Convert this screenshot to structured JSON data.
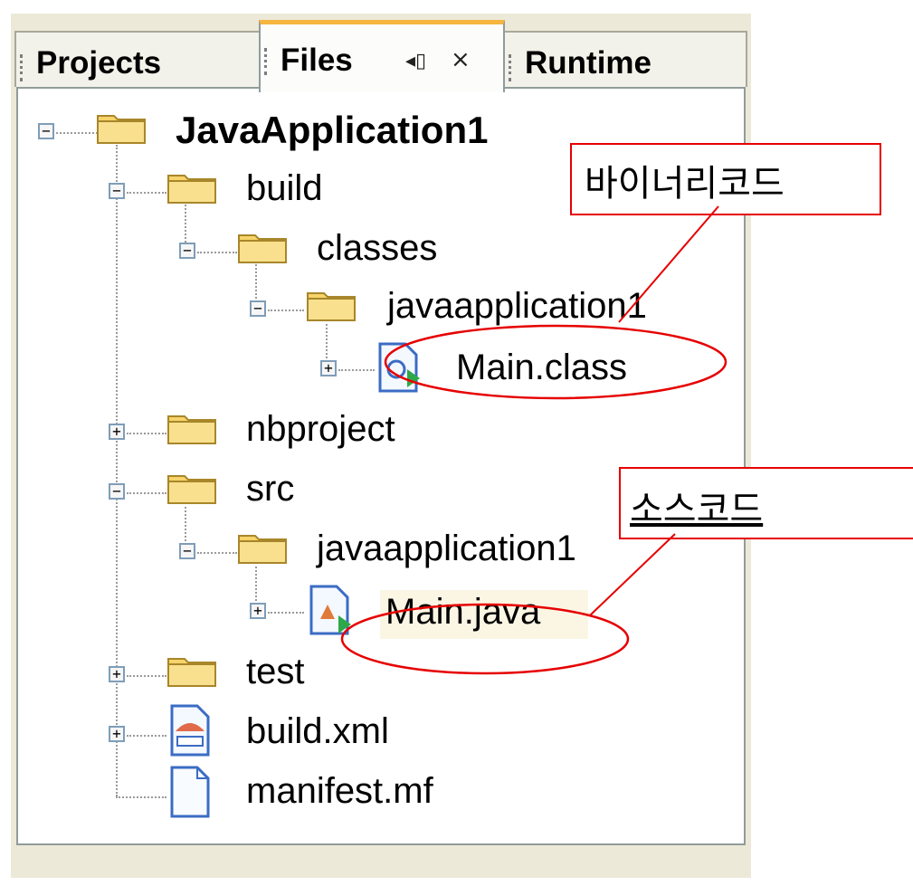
{
  "tabs": [
    {
      "label": "Projects"
    },
    {
      "label": "Files",
      "restore_icon": "◂▯",
      "close_icon": "×"
    },
    {
      "label": "Runtime"
    }
  ],
  "tree": {
    "root": "JavaApplication1",
    "build": "build",
    "classes": "classes",
    "pkg1": "javaapplication1",
    "main_class": "Main.class",
    "nbproject": "nbproject",
    "src": "src",
    "pkg2": "javaapplication1",
    "main_java": "Main.java",
    "test": "test",
    "build_xml": "build.xml",
    "manifest": "manifest.mf"
  },
  "annotations": {
    "binary": "바이너리코드",
    "source": "소스코드"
  },
  "colors": {
    "annotation": "#e60000",
    "folder": "#f2c94c",
    "active_tab": "#f5b53f"
  }
}
